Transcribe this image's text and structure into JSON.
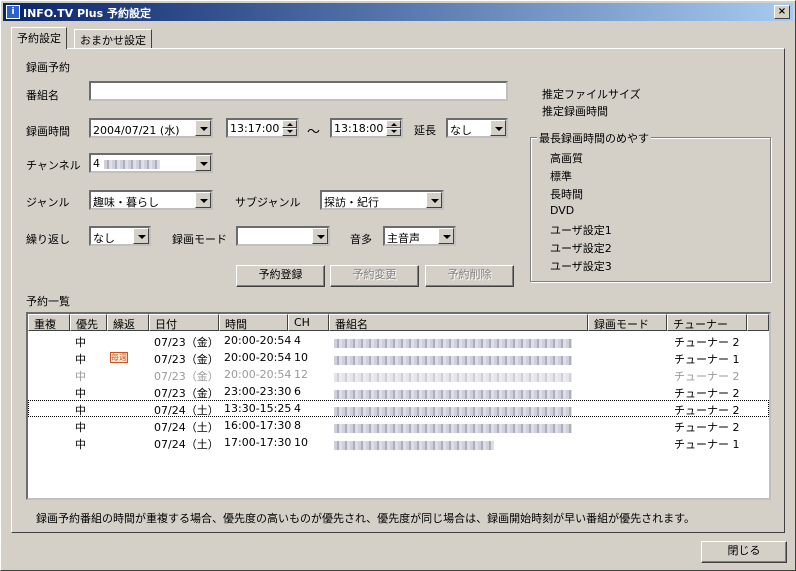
{
  "window": {
    "title": "INFO.TV Plus 予約設定",
    "close_glyph": "×",
    "icon_glyph": "i"
  },
  "tabs": [
    {
      "label": "予約設定"
    },
    {
      "label": "おまかせ設定"
    }
  ],
  "form": {
    "section_title": "録画予約",
    "program_label": "番組名",
    "program_value": "",
    "time_label": "録画時間",
    "date_value": "2004/07/21 (水)",
    "start_time": "13:17:00",
    "tilde": "～",
    "end_time": "13:18:00",
    "extend_label": "延長",
    "extend_value": "なし",
    "channel_label": "チャンネル",
    "channel_value": "4",
    "genre_label": "ジャンル",
    "genre_value": "趣味・暮らし",
    "subgenre_label": "サブジャンル",
    "subgenre_value": "探訪・紀行",
    "repeat_label": "繰り返し",
    "repeat_value": "なし",
    "mode_label": "録画モード",
    "mode_value": "",
    "audio_label": "音多",
    "audio_value": "主音声"
  },
  "info": {
    "file_size_label": "推定ファイルサイズ",
    "rec_time_label": "推定録画時間"
  },
  "guide": {
    "title": "最長録画時間のめやす",
    "items": [
      "高画質",
      "標準",
      "長時間",
      "DVD",
      "ユーザ設定1",
      "ユーザ設定2",
      "ユーザ設定3"
    ]
  },
  "buttons": {
    "register": "予約登録",
    "change": "予約変更",
    "delete": "予約削除",
    "close": "閉じる"
  },
  "list": {
    "title": "予約一覧",
    "columns": [
      "重複",
      "優先",
      "繰返",
      "日付",
      "時間",
      "CH",
      "番組名",
      "録画モード",
      "チューナー"
    ],
    "rows": [
      {
        "priority": "中",
        "repeat_icon": "",
        "date": "07/23（金）",
        "time": "20:00-20:54",
        "ch": "4",
        "tuner": "チューナー 2",
        "state": "normal"
      },
      {
        "priority": "中",
        "repeat_icon": "毎週",
        "date": "07/23（金）",
        "time": "20:00-20:54",
        "ch": "10",
        "tuner": "チューナー 1",
        "state": "normal"
      },
      {
        "priority": "中",
        "repeat_icon": "",
        "date": "07/23（金）",
        "time": "20:00-20:54",
        "ch": "12",
        "tuner": "チューナー 2",
        "state": "gray"
      },
      {
        "priority": "中",
        "repeat_icon": "",
        "date": "07/23（金）",
        "time": "23:00-23:30",
        "ch": "6",
        "tuner": "チューナー 2",
        "state": "normal"
      },
      {
        "priority": "中",
        "repeat_icon": "",
        "date": "07/24（土）",
        "time": "13:30-15:25",
        "ch": "4",
        "tuner": "チューナー 2",
        "state": "focused"
      },
      {
        "priority": "中",
        "repeat_icon": "",
        "date": "07/24（土）",
        "time": "16:00-17:30",
        "ch": "8",
        "tuner": "チューナー 2",
        "state": "normal"
      },
      {
        "priority": "中",
        "repeat_icon": "",
        "date": "07/24（土）",
        "time": "17:00-17:30",
        "ch": "10",
        "tuner": "チューナー 1",
        "state": "normal"
      }
    ]
  },
  "note": "録画予約番組の時間が重複する場合、優先度の高いものが優先され、優先度が同じ場合は、録画開始時刻が早い番組が優先されます。"
}
